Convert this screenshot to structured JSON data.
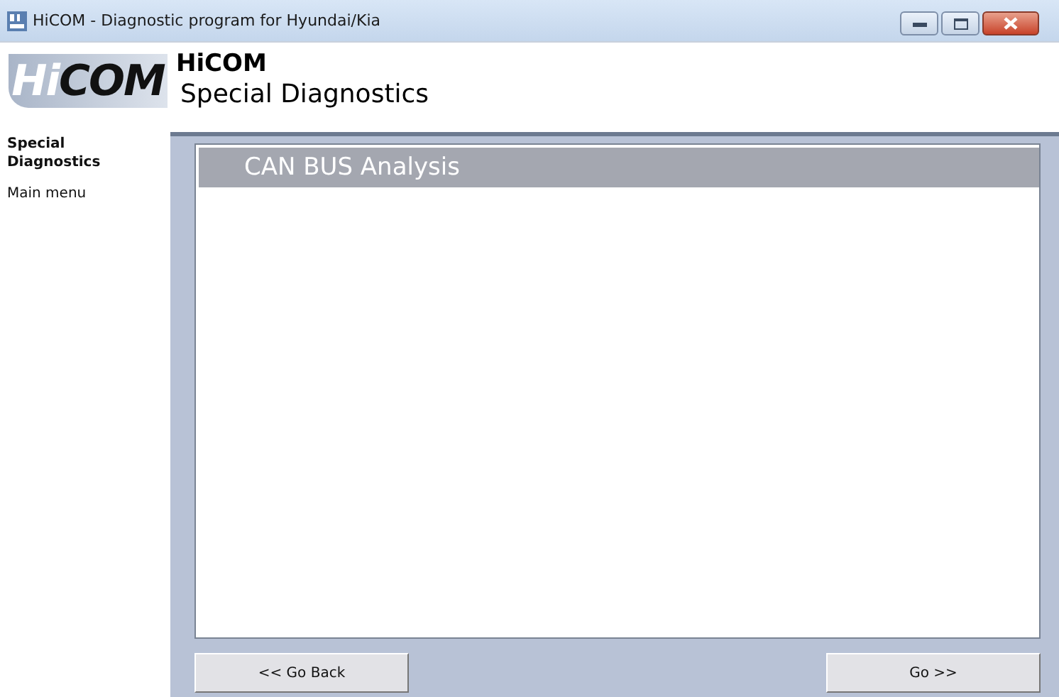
{
  "window": {
    "title": "HiCOM - Diagnostic program for Hyundai/Kia"
  },
  "logo": {
    "part_1": "Hi",
    "part_2": "COM"
  },
  "header": {
    "title": "HiCOM",
    "subtitle": "Special Diagnostics"
  },
  "sidebar": {
    "items": [
      {
        "label": "Special Diagnostics",
        "selected": true
      },
      {
        "label": "Main menu",
        "selected": false
      }
    ]
  },
  "list": {
    "header": "CAN BUS Analysis"
  },
  "buttons": {
    "back": "<< Go Back",
    "go": "Go >>"
  }
}
